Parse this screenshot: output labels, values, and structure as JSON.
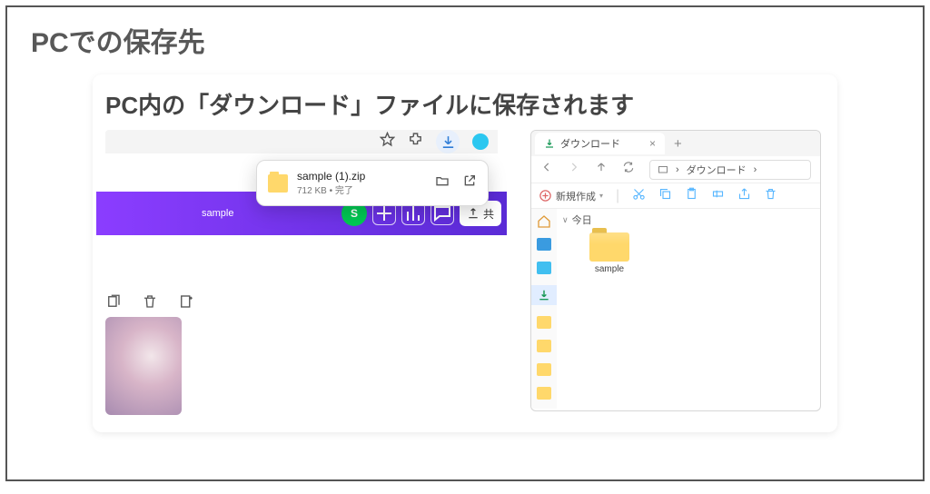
{
  "title": "PCでの保存先",
  "subtitle": "PC内の「ダウンロード」ファイルに保存されます",
  "download": {
    "filename": "sample (1).zip",
    "meta": "712 KB • 完了"
  },
  "canva": {
    "design_name": "sample",
    "avatar_initial": "S",
    "share_label": "共"
  },
  "explorer": {
    "tab": "ダウンロード",
    "breadcrumb_items": [
      "ダウンロード"
    ],
    "new_label": "新規作成",
    "group_header": "今日",
    "folder_name": "sample"
  }
}
